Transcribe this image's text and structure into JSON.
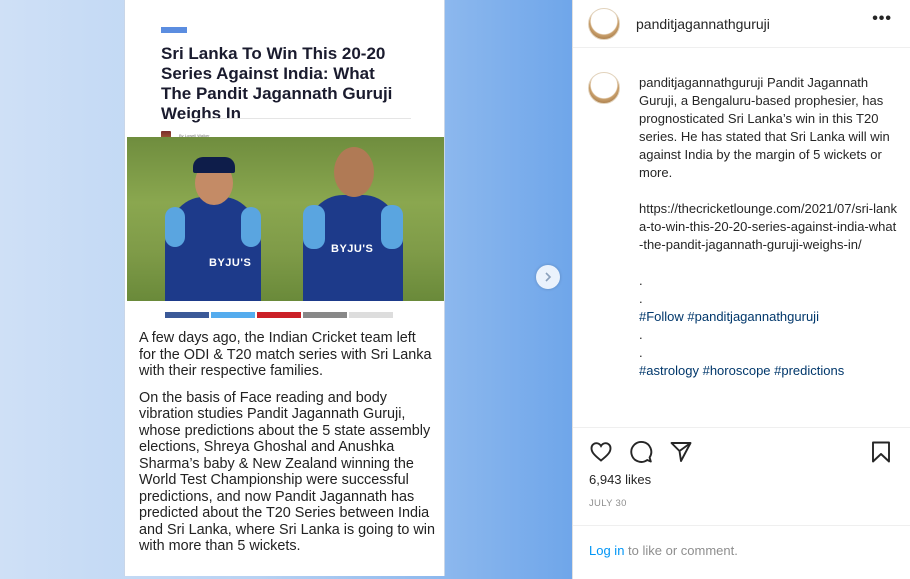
{
  "media": {
    "category_tag": "",
    "article_title": "Sri Lanka To Win This 20-20 Series Against India: What The Pandit Jagannath Guruji Weighs In",
    "byline": "By Lowell Walker",
    "byline_date": "Posted on July 28, 2021",
    "photo_logo_1": "BYJU'S",
    "photo_logo_2": "BYJU'S",
    "paragraph_1": "A few days ago, the Indian Cricket team left for the ODI & T20 match series with Sri Lanka with their respective families.",
    "paragraph_2": "On the basis of Face reading and body vibration studies Pandit Jagannath Guruji, whose predictions about the 5 state assembly elections, Shreya Ghoshal and Anushka Sharma’s baby & New Zealand winning the World Test Championship were successful predictions, and now Pandit Jagannath has predicted about the T20 Series between India and Sri Lanka, where Sri Lanka is going to win with more than 5 wickets.",
    "share_colors": [
      "#3b5998",
      "#55acee",
      "#cb2027",
      "#888888",
      "#dddddd"
    ]
  },
  "header": {
    "username": "panditjagannathguruji",
    "more_icon": "more-horizontal-icon"
  },
  "caption": {
    "username": "panditjagannathguruji",
    "text": "Pandit Jagannath Guruji, a Bengaluru-based prophesier, has prognosticated Sri Lanka’s win in this T20 series. He has stated that Sri Lanka will win against India by the margin of 5 wickets or more.",
    "link": "https://thecricketlounge.com/2021/07/sri-lanka-to-win-this-20-20-series-against-india-what-the-pandit-jagannath-guruji-weighs-in/",
    "dot1": ".",
    "dot2": ".",
    "tags_line_1": "#Follow #panditjagannathguruji",
    "dot3": ".",
    "dot4": ".",
    "tags_line_2": "#astrology #horoscope #predictions"
  },
  "actions": {
    "like_icon": "heart-icon",
    "comment_icon": "comment-icon",
    "share_icon": "send-icon",
    "save_icon": "bookmark-icon"
  },
  "likes": "6,943 likes",
  "date": "JULY 30",
  "login": {
    "link": "Log in",
    "rest": " to like or comment."
  }
}
